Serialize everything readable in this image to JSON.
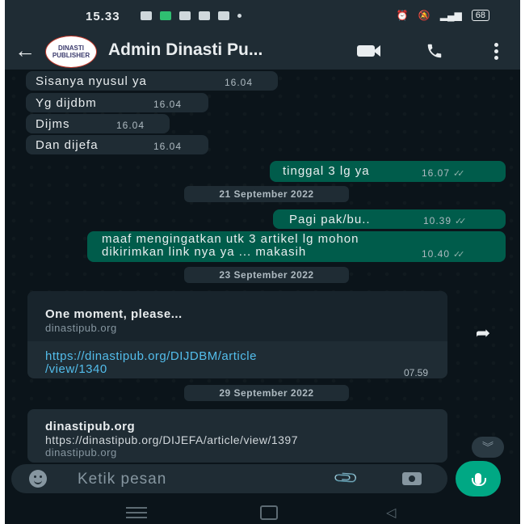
{
  "status_bar": {
    "time": "15.33",
    "battery": "68"
  },
  "header": {
    "back_icon": "arrow-left-icon",
    "avatar_text": "DINASTI PUBLISHER",
    "title": "Admin Dinasti Pu..."
  },
  "messages": [
    {
      "dir": "in",
      "text": "Sisanya nyusul ya",
      "time": "16.04"
    },
    {
      "dir": "in",
      "text": "Yg dijdbm",
      "time": "16.04"
    },
    {
      "dir": "in",
      "text": "Dijms",
      "time": "16.04"
    },
    {
      "dir": "in",
      "text": "Dan dijefa",
      "time": "16.04"
    },
    {
      "dir": "out",
      "text": "tinggal 3 lg ya",
      "time": "16.07"
    }
  ],
  "dates": [
    "21 September 2022",
    "23 September 2022",
    "29 September 2022"
  ],
  "messages_21sep": [
    {
      "dir": "out",
      "text": "Pagi pak/bu..",
      "time": "10.39"
    },
    {
      "dir": "out",
      "line1": "maaf mengingatkan utk 3 artikel lg mohon",
      "line2": "dikirimkan link nya ya ... makasih",
      "time": "10.40"
    }
  ],
  "link_card_1": {
    "preview_title": "One moment, please...",
    "preview_domain": "dinastipub.org",
    "link_line1": "https://dinastipub.org/DIJDBM/article",
    "link_line2": "/view/1340",
    "time": "07.59"
  },
  "link_card_2": {
    "preview_title": "dinastipub.org",
    "preview_url": "https://dinastipub.org/DIJEFA/article/view/1397",
    "preview_domain": "dinastipub.org"
  },
  "input": {
    "placeholder": "Ketik pesan"
  },
  "colors": {
    "incoming": "#1f2c34",
    "outgoing": "#005c4b",
    "accent": "#00a884",
    "link": "#53bdeb"
  }
}
